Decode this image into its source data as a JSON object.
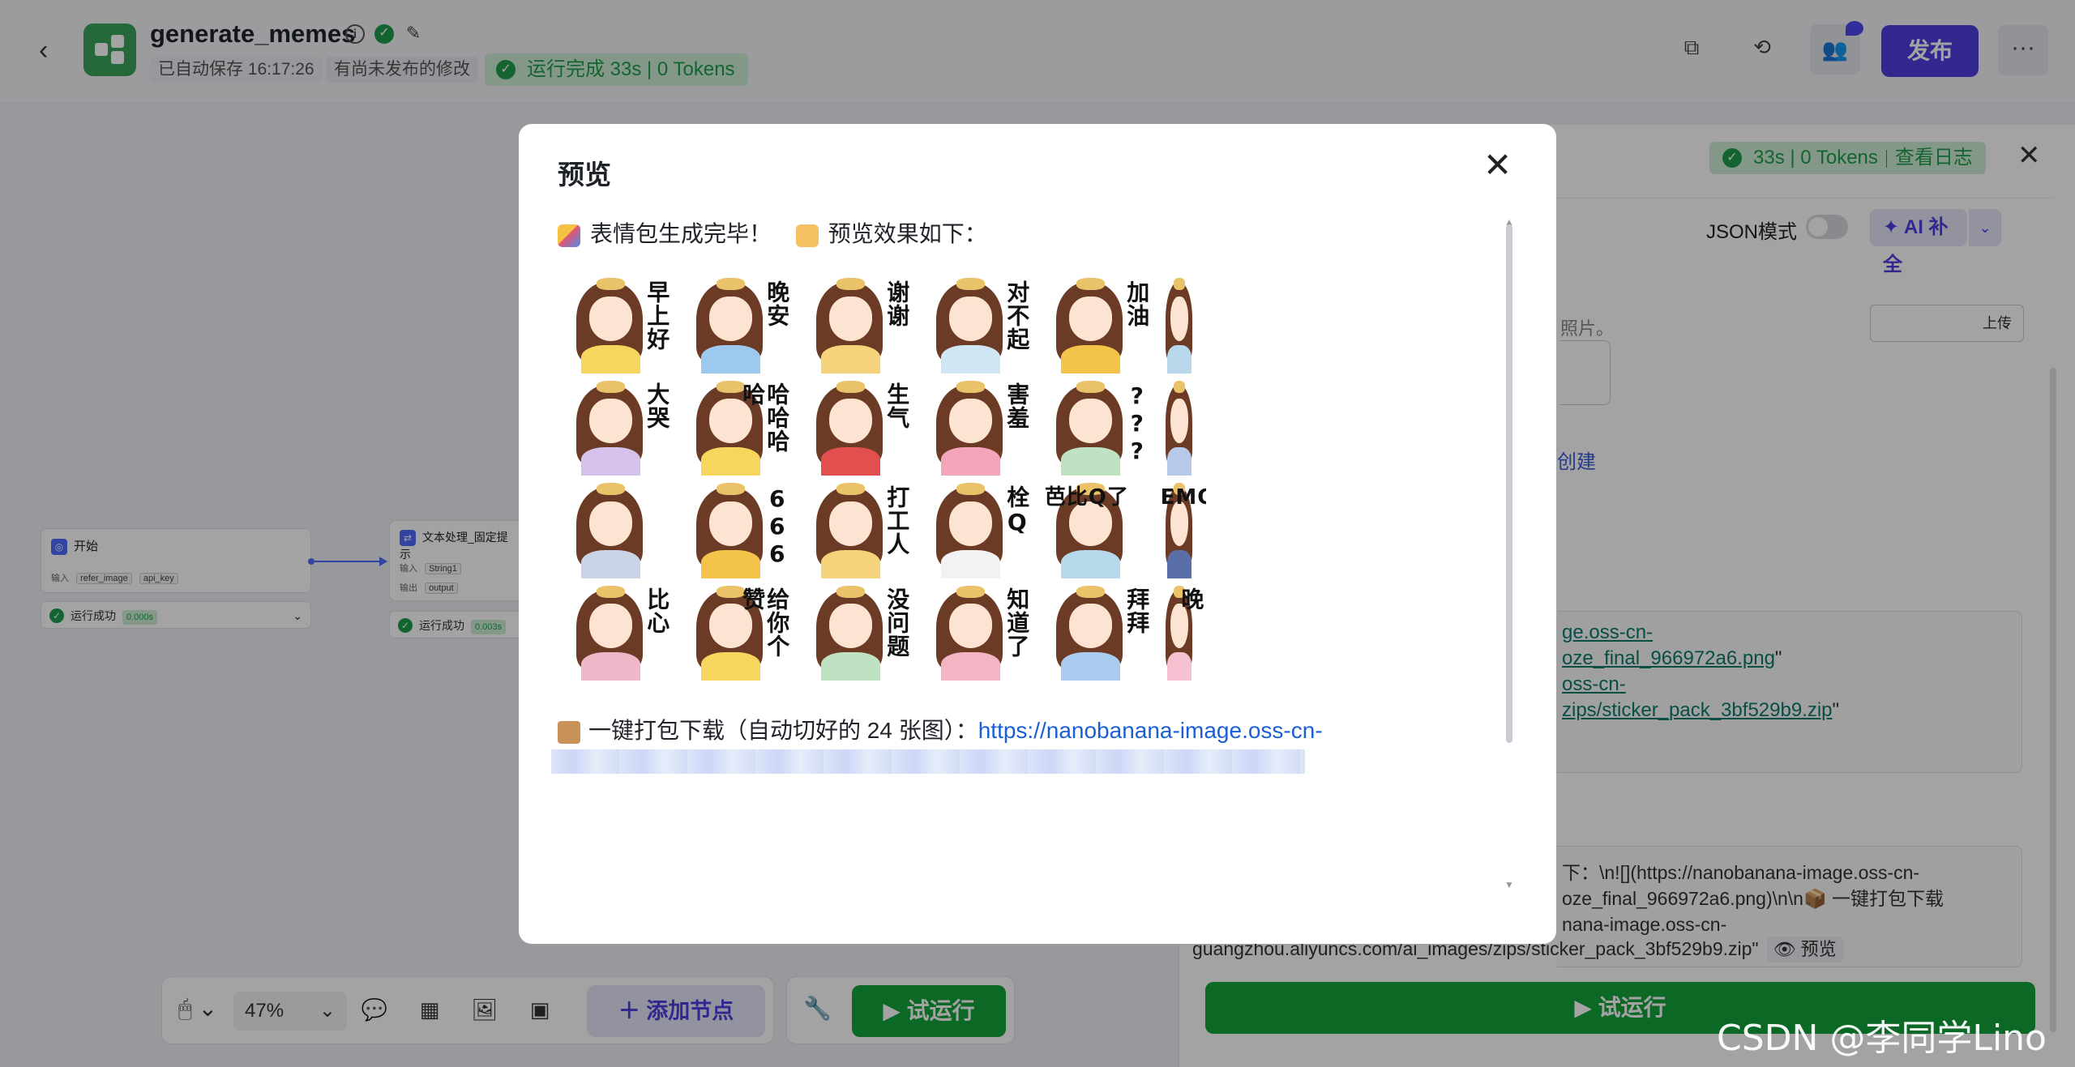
{
  "header": {
    "app_name": "generate_memes",
    "autosave": "已自动保存 16:17:26",
    "unpublished": "有尚未发布的修改",
    "run_status": "运行完成 33s | 0 Tokens",
    "publish_label": "发布"
  },
  "canvas": {
    "start_node": {
      "title": "开始",
      "input_label": "输入",
      "inputs": [
        "refer_image",
        "api_key"
      ],
      "status": "运行成功",
      "duration": "0.000s"
    },
    "text_node": {
      "title": "文本处理_固定提示",
      "input_label": "输入",
      "input": "String1",
      "output_label": "输出",
      "output": "output",
      "status": "运行成功",
      "duration": "0.003s"
    }
  },
  "toolbar": {
    "zoom": "47%",
    "add_node_label": "添加节点",
    "run_label": "试运行"
  },
  "right_panel": {
    "status": "33s | 0 Tokens",
    "log_link": "查看日志",
    "json_mode_label": "JSON模式",
    "ai_label": "AI 补全",
    "photo_hint": "照片。",
    "upload_label": "上传",
    "create_link": "创建",
    "output_line1": "ge.oss-cn-",
    "output_line2": "oze_final_966972a6.png",
    "output_line3": "oss-cn-",
    "output_line4": "zips/sticker_pack_3bf529b9.zip",
    "raw_line1": "下：\\n![](https://nanobanana-image.oss-cn-",
    "raw_line2": "oze_final_966972a6.png)\\n\\n📦 一键打包下载",
    "raw_line3": "nana-image.oss-cn-",
    "raw_line4": "guangzhou.aliyuncs.com/ai_images/zips/sticker_pack_3bf529b9.zip\"",
    "preview_chip": "预览",
    "run_label": "试运行"
  },
  "modal": {
    "title": "预览",
    "line_text": "表情包生成完毕！",
    "line_text2": "预览效果如下：",
    "stickers": [
      [
        "早上好",
        "晚安",
        "谢谢",
        "对不起",
        "加油",
        ""
      ],
      [
        "大哭",
        "哈哈哈哈",
        "生气",
        "害羞",
        "???",
        ""
      ],
      [
        "",
        "666",
        "打工人",
        "栓Q",
        "芭比Q了",
        "EMO"
      ],
      [
        "比心",
        "给你个赞",
        "没问题",
        "知道了",
        "拜拜",
        "晚"
      ]
    ],
    "download_text": "一键打包下载（自动切好的 24 张图）：",
    "download_link": "https://nanobanana-image.oss-cn-"
  },
  "watermark": "CSDN @李同学Lino",
  "colors": {
    "accent": "#4d3ee0",
    "success": "#1f9d4c",
    "run_button": "#14a33a",
    "link": "#1a5fd6"
  }
}
